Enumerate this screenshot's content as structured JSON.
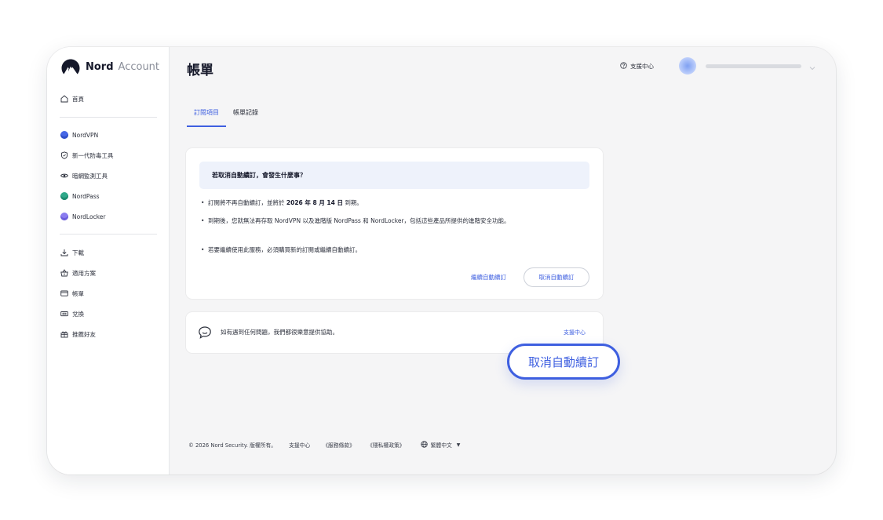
{
  "brand": {
    "name": "Nord",
    "product": "Account"
  },
  "sidebar": {
    "home": {
      "label": "首頁",
      "icon": "home-icon"
    },
    "products": [
      {
        "label": "NordVPN",
        "icon": "nordvpn-icon",
        "color": "#4667e6"
      },
      {
        "label": "新一代防毒工具",
        "icon": "shield-icon"
      },
      {
        "label": "暗網監測工具",
        "icon": "eye-icon"
      },
      {
        "label": "NordPass",
        "icon": "nordpass-icon",
        "color": "#2fa98a"
      },
      {
        "label": "NordLocker",
        "icon": "nordlocker-icon",
        "color": "#8a7cf0"
      }
    ],
    "tools": [
      {
        "label": "下載",
        "icon": "download-icon"
      },
      {
        "label": "適用方案",
        "icon": "basket-icon"
      },
      {
        "label": "帳單",
        "icon": "card-icon"
      },
      {
        "label": "兌換",
        "icon": "ticket-icon"
      },
      {
        "label": "推薦好友",
        "icon": "gift-icon"
      }
    ]
  },
  "header": {
    "title": "帳單",
    "help": "支援中心",
    "help_icon": "question-circle-icon",
    "user_chevron_icon": "chevron-down-icon"
  },
  "tabs": [
    {
      "label": "訂閱項目",
      "active": true
    },
    {
      "label": "帳單記錄",
      "active": false
    }
  ],
  "cancel_card": {
    "banner": "若取消自動續訂，會發生什麼事？",
    "bullet1_pre": "訂閱將不再自動續訂，並將於 ",
    "bullet1_date": "2026 年 8 月 14 日",
    "bullet1_post": " 到期。",
    "bullet2": "到期後，您就無法再存取 NordVPN 以及進階版 NordPass 和 NordLocker，包括這些產品所提供的進階安全功能。",
    "bullet3": "若要繼續使用此服務，必須購買新的訂閱或繼續自動續訂。",
    "continue_label": "繼續自動續訂",
    "cancel_label": "取消自動續訂"
  },
  "help_card": {
    "message": "如有遇到任何問題，我們都很樂意提供協助。",
    "link": "支援中心",
    "icon": "chat-bubble-icon"
  },
  "callout": {
    "label": "取消自動續訂"
  },
  "footer": {
    "copyright": "© 2026 Nord Security. 版權所有。",
    "links": [
      "支援中心",
      "《服務條款》",
      "《隱私權政策》"
    ],
    "language": "繁體中文",
    "language_icon": "globe-icon"
  },
  "colors": {
    "accent": "#3e5fe0",
    "banner_bg": "#eef2fb",
    "page_bg": "#f5f5f6"
  }
}
